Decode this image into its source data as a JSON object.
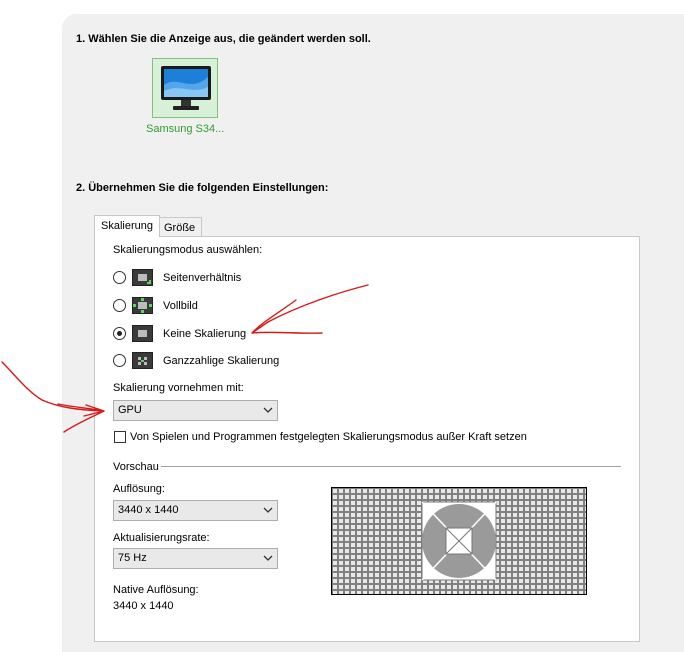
{
  "steps": {
    "step1": "1. Wählen Sie die Anzeige aus, die geändert werden soll.",
    "step2": "2. Übernehmen Sie die folgenden Einstellungen:"
  },
  "display": {
    "name": "Samsung S34..."
  },
  "tabs": [
    {
      "label": "Skalierung",
      "active": true
    },
    {
      "label": "Größe",
      "active": false
    }
  ],
  "scaling": {
    "mode_heading": "Skalierungsmodus auswählen:",
    "modes": [
      {
        "label": "Seitenverhältnis",
        "selected": false
      },
      {
        "label": "Vollbild",
        "selected": false
      },
      {
        "label": "Keine Skalierung",
        "selected": true
      },
      {
        "label": "Ganzzahlige Skalierung",
        "selected": false
      }
    ],
    "perform_with_label": "Skalierung vornehmen mit:",
    "perform_with_value": "GPU",
    "override_label": "Von Spielen und Programmen festgelegten Skalierungsmodus außer Kraft setzen",
    "override_checked": false
  },
  "preview": {
    "heading": "Vorschau",
    "resolution_label": "Auflösung:",
    "resolution_value": "3440 x 1440",
    "refresh_label": "Aktualisierungsrate:",
    "refresh_value": "75 Hz",
    "native_label": "Native Auflösung:",
    "native_value": "3440 x 1440"
  },
  "colors": {
    "selected_display_bg": "#d8f0d8",
    "selected_display_border": "#7bc47b",
    "display_name": "#2f9e2f",
    "annotation": "#d61a1a"
  }
}
